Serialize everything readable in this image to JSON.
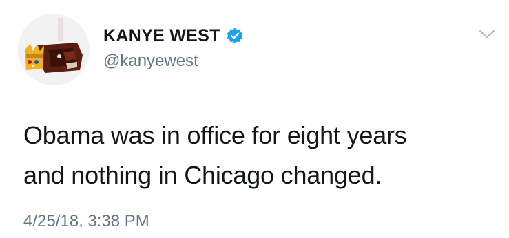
{
  "author": {
    "display_name": "KANYE WEST",
    "handle": "@kanyewest",
    "verified": true,
    "avatar_icon": "crowned-bear-mask-avatar"
  },
  "menu": {
    "icon": "chevron-down-icon"
  },
  "tweet": {
    "lines": [
      "Obama was in office for eight years",
      "and nothing in Chicago changed."
    ],
    "timestamp": "4/25/18, 3:38 PM"
  },
  "colors": {
    "text": "#14171a",
    "secondary_text": "#657786",
    "verified_badge": "#1da1f2",
    "caret": "#aab8c2"
  }
}
